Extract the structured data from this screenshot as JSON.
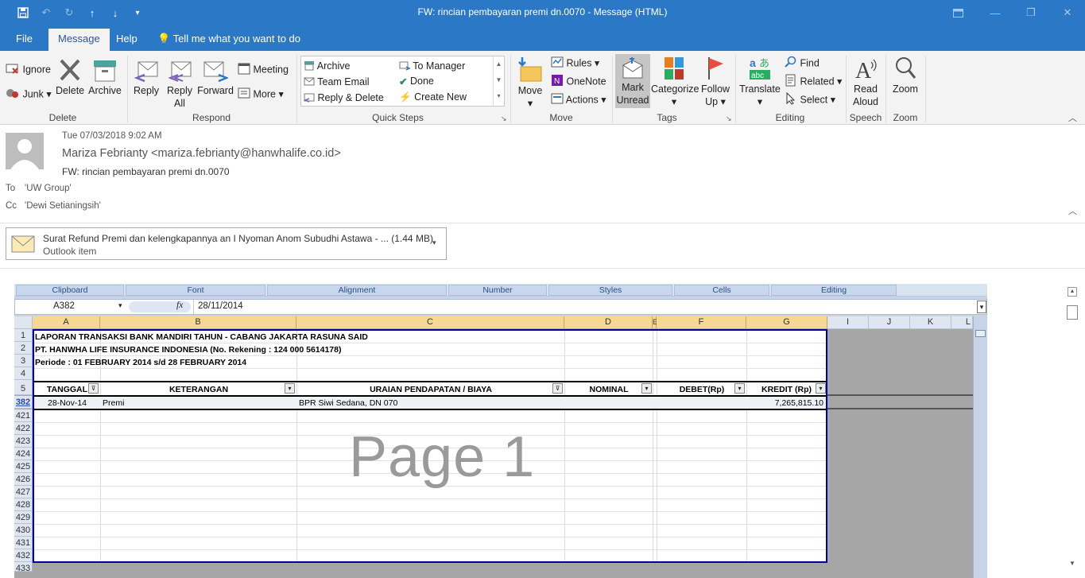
{
  "window": {
    "title": "FW: rincian pembayaran premi dn.0070  -  Message (HTML)"
  },
  "menu": {
    "file": "File",
    "message": "Message",
    "help": "Help",
    "tell_me": "Tell me what you want to do"
  },
  "ribbon": {
    "delete_group": {
      "ignore": "Ignore",
      "junk": "Junk",
      "delete": "Delete",
      "archive": "Archive",
      "label": "Delete"
    },
    "respond_group": {
      "reply": "Reply",
      "reply_all_1": "Reply",
      "reply_all_2": "All",
      "forward": "Forward",
      "meeting": "Meeting",
      "more": "More",
      "label": "Respond"
    },
    "quick_steps": {
      "archive": "Archive",
      "team_email": "Team Email",
      "reply_delete": "Reply & Delete",
      "to_manager": "To Manager",
      "done": "Done",
      "create_new": "Create New",
      "label": "Quick Steps"
    },
    "move_group": {
      "move": "Move",
      "rules": "Rules",
      "onenote": "OneNote",
      "actions": "Actions",
      "label": "Move"
    },
    "tags_group": {
      "mark_unread_1": "Mark",
      "mark_unread_2": "Unread",
      "categorize": "Categorize",
      "follow_up_1": "Follow",
      "follow_up_2": "Up",
      "label": "Tags"
    },
    "editing_group": {
      "translate": "Translate",
      "find": "Find",
      "related": "Related",
      "select": "Select",
      "label": "Editing"
    },
    "speech_group": {
      "read_aloud_1": "Read",
      "read_aloud_2": "Aloud",
      "label": "Speech"
    },
    "zoom_group": {
      "zoom": "Zoom",
      "label": "Zoom"
    }
  },
  "message": {
    "date": "Tue 07/03/2018 9:02 AM",
    "sender": "Mariza Febrianty <mariza.febrianty@hanwhalife.co.id>",
    "subject": "FW: rincian pembayaran premi dn.0070",
    "to_label": "To",
    "to_value": "'UW Group'",
    "cc_label": "Cc",
    "cc_value": "'Dewi Setianingsih'",
    "attachment_name": "Surat Refund Premi dan kelengkapannya an I Nyoman Anom Subudhi Astawa - ... (1.44 MB)",
    "attachment_type": "Outlook item"
  },
  "excel": {
    "ribbon_groups": [
      "Clipboard",
      "Font",
      "Alignment",
      "Number",
      "Styles",
      "Cells",
      "Editing"
    ],
    "name_box": "A382",
    "formula": "28/11/2014",
    "fx": "fx",
    "columns": [
      "A",
      "B",
      "C",
      "D",
      "E",
      "F",
      "G",
      "I",
      "J",
      "K",
      "L"
    ],
    "row_numbers": [
      "1",
      "2",
      "3",
      "4",
      "5",
      "382",
      "421",
      "422",
      "423",
      "424",
      "425",
      "426",
      "427",
      "428",
      "429",
      "430",
      "431",
      "432",
      "433"
    ],
    "title1": "LAPORAN TRANSAKSI BANK MANDIRI TAHUN - CABANG JAKARTA RASUNA SAID",
    "title2": "PT. HANWHA LIFE INSURANCE INDONESIA (No. Rekening : 124 000 5614178)",
    "title3": "Periode : 01 FEBRUARY 2014 s/d 28 FEBRUARY 2014",
    "headers": {
      "tanggal": "TANGGAL",
      "keterangan": "KETERANGAN",
      "uraian": "URAIAN PENDAPATAN / BIAYA",
      "nominal": "NOMINAL",
      "debet": "DEBET(Rp)",
      "kredit": "KREDIT (Rp)"
    },
    "row382": {
      "tanggal": "28-Nov-14",
      "keterangan": "Premi",
      "uraian": "BPR Siwi Sedana, DN 070",
      "kredit": "7,265,815.10"
    },
    "watermark": "Page 1"
  }
}
